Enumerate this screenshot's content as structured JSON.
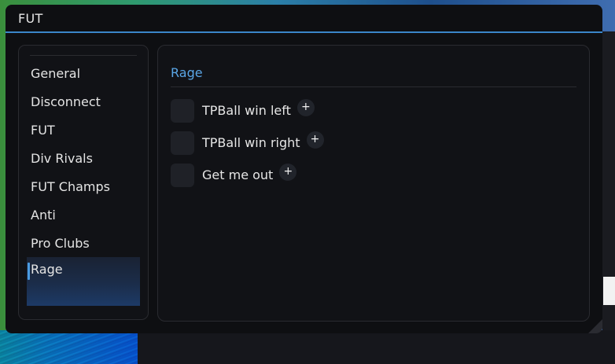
{
  "window": {
    "title": "FUT"
  },
  "sidebar": {
    "items": [
      {
        "label": "General"
      },
      {
        "label": "Disconnect"
      },
      {
        "label": "FUT"
      },
      {
        "label": "Div Rivals"
      },
      {
        "label": "FUT Champs"
      },
      {
        "label": "Anti"
      },
      {
        "label": "Pro Clubs"
      },
      {
        "label": "Rage",
        "active": true
      }
    ]
  },
  "content": {
    "section_title": "Rage",
    "rows": [
      {
        "label": "TPBall win left",
        "checked": false,
        "add_icon": "+"
      },
      {
        "label": "TPBall win right",
        "checked": false,
        "add_icon": "+"
      },
      {
        "label": "Get me out",
        "checked": false,
        "add_icon": "+"
      }
    ]
  },
  "colors": {
    "accent": "#3b86c9",
    "section_title": "#5aa6e6",
    "background": "#0e0f12",
    "panel": "#111216"
  },
  "icons": {
    "add": "plus-icon"
  }
}
